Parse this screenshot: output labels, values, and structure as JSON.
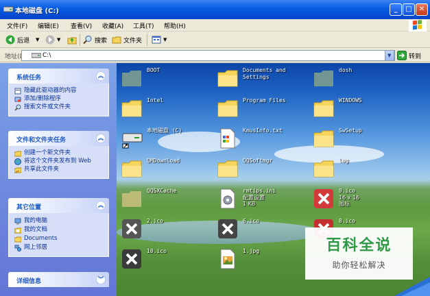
{
  "window": {
    "title": "本地磁盘 (C:)"
  },
  "menu": {
    "items": [
      "文件(F)",
      "编辑(E)",
      "查看(V)",
      "收藏(A)",
      "工具(T)",
      "帮助(H)"
    ]
  },
  "toolbar": {
    "back": "后退",
    "search": "搜索",
    "folders": "文件夹"
  },
  "address": {
    "label": "地址(D)",
    "value": "C:\\",
    "go": "转到"
  },
  "taskpane": {
    "system": {
      "title": "系统任务",
      "items": [
        "隐藏此驱动器的内容",
        "添加/删除程序",
        "搜索文件或文件夹"
      ]
    },
    "file": {
      "title": "文件和文件夹任务",
      "items": [
        "创建一个新文件夹",
        "将这个文件夹发布到 Web",
        "共享此文件夹"
      ]
    },
    "other": {
      "title": "其它位置",
      "items": [
        "我的电脑",
        "我的文档",
        "Documents",
        "网上邻居"
      ]
    },
    "details": {
      "title": "详细信息"
    }
  },
  "files": [
    {
      "name": "BOOT"
    },
    {
      "name": "Documents and Settings"
    },
    {
      "name": "dosh"
    },
    {
      "name": "Intel"
    },
    {
      "name": "Program Files"
    },
    {
      "name": "WINDOWS"
    },
    {
      "name": "本地磁盘 (C)",
      "sub": ""
    },
    {
      "name": "KmusInfo.txt",
      "sub": ""
    },
    {
      "name": "SwSetup"
    },
    {
      "name": "QMDownload"
    },
    {
      "name": "QQSoftmgr"
    },
    {
      "name": "log"
    },
    {
      "name": "QQSXCache"
    },
    {
      "name": "rmtips.ini",
      "sub": "配置设置",
      "sub2": "1 KB"
    },
    {
      "name": "0.ico",
      "sub": "16 x 16",
      "sub2": "图标"
    },
    {
      "name": "2.ico"
    },
    {
      "name": "6.ico"
    },
    {
      "name": "8.ico"
    },
    {
      "name": "10.ico"
    },
    {
      "name": "1.jpg"
    }
  ],
  "watermark": {
    "title": "百科全说",
    "subtitle": "助你轻松解决"
  },
  "colors": {
    "title_bar": "#0a5fe3",
    "taskpane": "#6f8fde",
    "watermark_green": "#2f9a46"
  }
}
